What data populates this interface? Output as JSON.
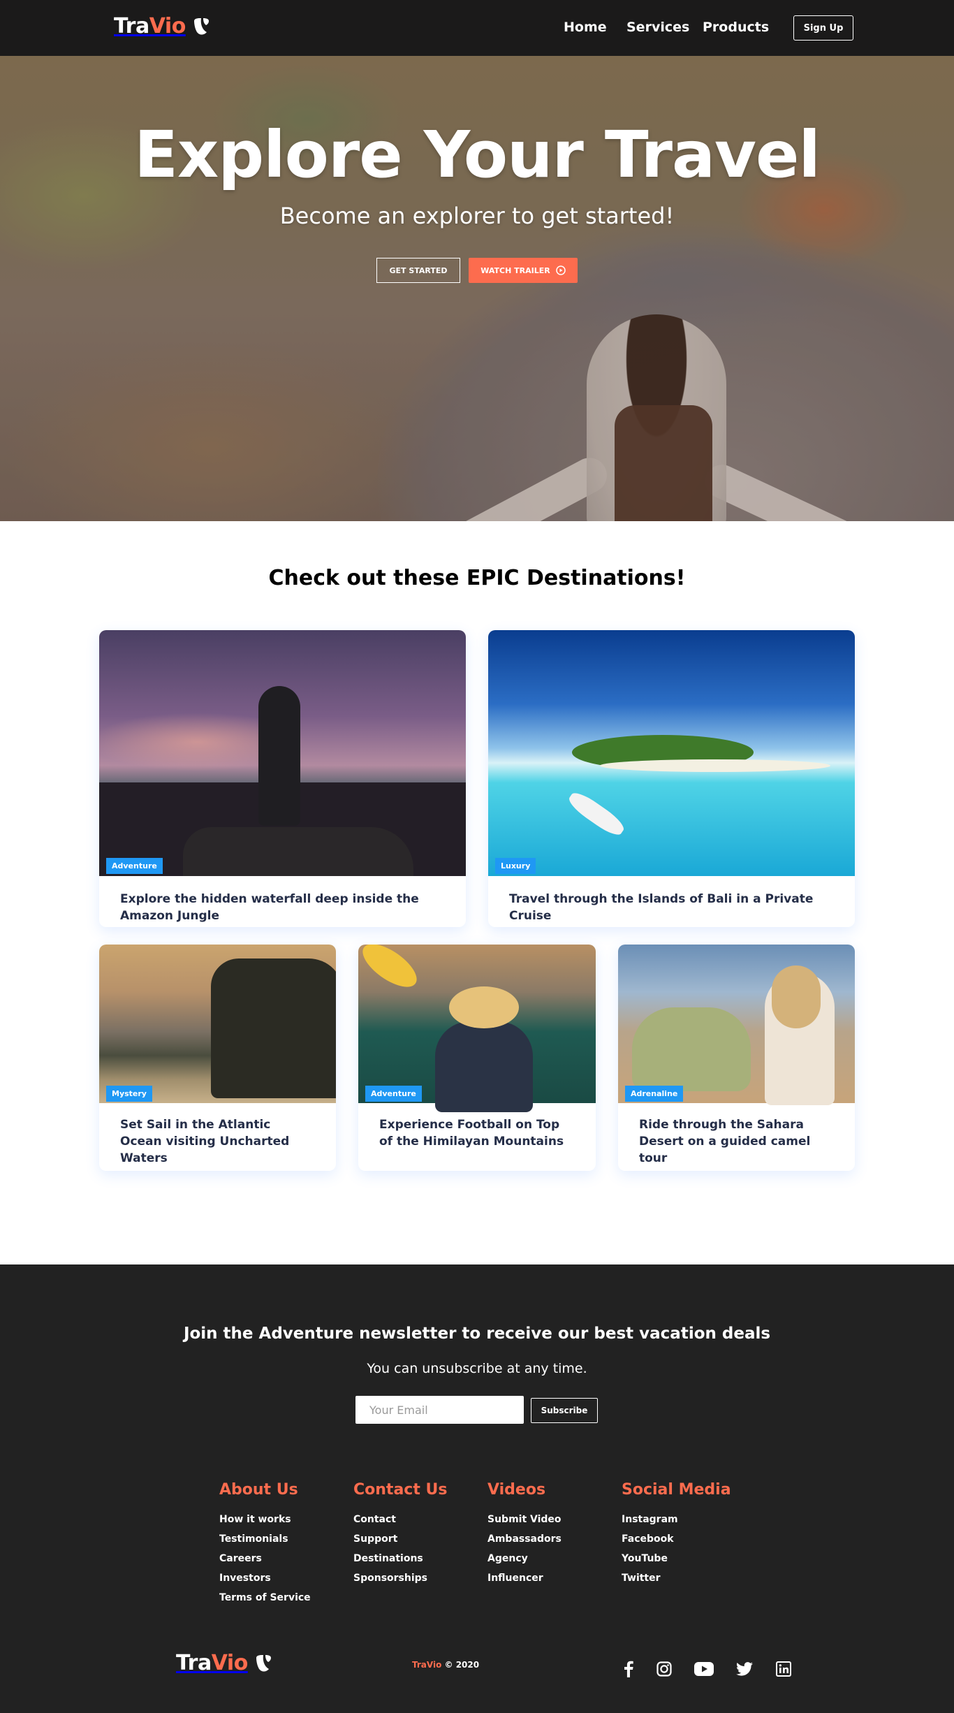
{
  "brand": {
    "tra": "Tra",
    "vio": "Vio"
  },
  "nav": {
    "links": [
      "Home",
      "Services",
      "Products"
    ],
    "signup_label": "Sign Up"
  },
  "hero": {
    "title": "Explore Your Travel",
    "subtitle": "Become an explorer to get started!",
    "get_started_label": "GET STARTED",
    "watch_trailer_label": "WATCH TRAILER"
  },
  "destinations": {
    "title": "Check out these EPIC Destinations!",
    "cards": [
      {
        "badge": "Adventure",
        "text": "Explore the hidden waterfall deep inside the Amazon Jungle"
      },
      {
        "badge": "Luxury",
        "text": "Travel through the Islands of Bali in a Private Cruise"
      },
      {
        "badge": "Mystery",
        "text": "Set Sail in the Atlantic Ocean visiting Uncharted Waters"
      },
      {
        "badge": "Adventure",
        "text": "Experience Football on Top of the Himilayan Mountains"
      },
      {
        "badge": "Adrenaline",
        "text": "Ride through the Sahara Desert on a guided camel tour"
      }
    ]
  },
  "newsletter": {
    "title": "Join the Adventure newsletter to receive our best vacation deals",
    "subtitle": "You can unsubscribe at any time.",
    "email_placeholder": "Your Email",
    "subscribe_label": "Subscribe"
  },
  "footer": {
    "columns": [
      {
        "heading": "About Us",
        "links": [
          "How it works",
          "Testimonials",
          "Careers",
          "Investors",
          "Terms of Service"
        ]
      },
      {
        "heading": "Contact Us",
        "links": [
          "Contact",
          "Support",
          "Destinations",
          "Sponsorships"
        ]
      },
      {
        "heading": "Videos",
        "links": [
          "Submit Video",
          "Ambassadors",
          "Agency",
          "Influencer"
        ]
      },
      {
        "heading": "Social Media",
        "links": [
          "Instagram",
          "Facebook",
          "YouTube",
          "Twitter"
        ]
      }
    ],
    "copyright_brand": "TraVio",
    "copyright_rest": "© 2020",
    "social_icons": [
      "facebook-icon",
      "instagram-icon",
      "youtube-icon",
      "twitter-icon",
      "linkedin-icon"
    ]
  },
  "colors": {
    "accent": "#fd6c4e",
    "badge": "#1f98f4",
    "nav_bg": "#1b1a1a",
    "footer_bg": "#222222"
  }
}
